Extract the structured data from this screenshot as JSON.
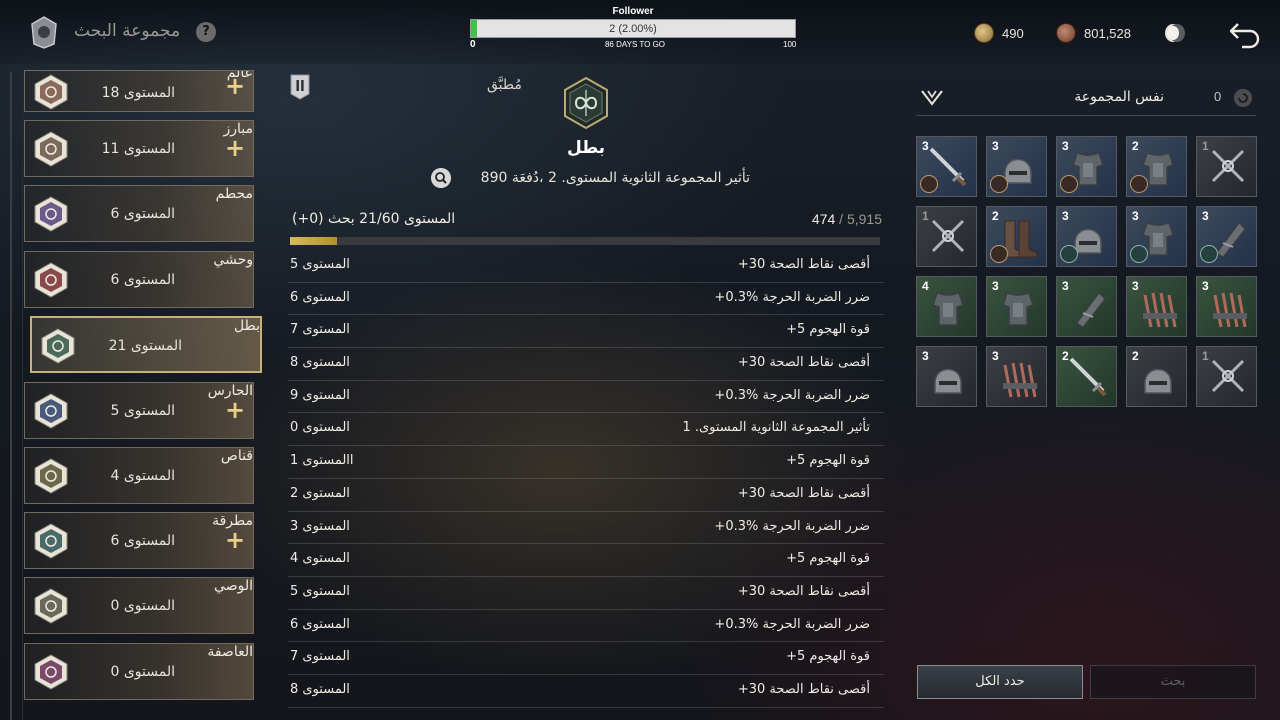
{
  "header": {
    "title": "مجموعة البحث",
    "help_label": "?"
  },
  "progress": {
    "title": "Follower",
    "value_text": "2 (2.00%)",
    "percent": 2.0,
    "min": "0",
    "max": "100",
    "days_left": "86 DAYS TO GO"
  },
  "resources": {
    "currency_a": "490",
    "currency_b": "801,528"
  },
  "left_list": [
    {
      "name": "عالم",
      "level": "المستوى 18",
      "plus": true,
      "emblem": "winged-emblem-icon"
    },
    {
      "name": "مبارز",
      "level": "المستوى 11",
      "plus": true,
      "emblem": "crossed-swords-emblem-icon"
    },
    {
      "name": "محطم",
      "level": "المستوى 6",
      "plus": false,
      "emblem": "fist-emblem-icon"
    },
    {
      "name": "وحشي",
      "level": "المستوى 6",
      "plus": false,
      "emblem": "beast-mask-emblem-icon"
    },
    {
      "name": "بطل",
      "level": "المستوى 21",
      "plus": false,
      "emblem": "infinity-emblem-icon",
      "selected": true
    },
    {
      "name": "الحارس",
      "level": "المستوى 5",
      "plus": true,
      "emblem": "gate-emblem-icon"
    },
    {
      "name": "قناص",
      "level": "المستوى 4",
      "plus": false,
      "emblem": "crosshair-emblem-icon"
    },
    {
      "name": "مطرقة",
      "level": "المستوى 6",
      "plus": true,
      "emblem": "hammer-emblem-icon"
    },
    {
      "name": "الوصي",
      "level": "المستوى 0",
      "plus": false,
      "emblem": "shield-emblem-icon"
    },
    {
      "name": "العاصفة",
      "level": "المستوى 0",
      "plus": false,
      "emblem": "swirl-emblem-icon"
    }
  ],
  "detail": {
    "applied_label": "مُطبَّق",
    "hero_name": "بطل",
    "sub_effect": "تأثير المجموعة الثانوية المستوى. 2 ،دُفعَة 890",
    "level_line": "(+0) المستوى 21/60 بحث",
    "xp_current": "474",
    "xp_sep": " / ",
    "xp_max": "5,915",
    "xp_fraction": 0.08,
    "rows": [
      {
        "level": "المستوى 5",
        "effect": "+30 أقصى نقاط الصحة"
      },
      {
        "level": "المستوى 6",
        "effect": "+0.3% ضرر الضربة الحرجة"
      },
      {
        "level": "المستوى 7",
        "effect": "+5 قوة الهجوم"
      },
      {
        "level": "المستوى 8",
        "effect": "+30 أقصى نقاط الصحة"
      },
      {
        "level": "المستوى 9",
        "effect": "+0.3% ضرر الضربة الحرجة"
      },
      {
        "level": "المستوى 0",
        "effect": "تأثير المجموعة الثانوية المستوى. 1"
      },
      {
        "level": "المستوى 1l",
        "effect": "+5 قوة الهجوم"
      },
      {
        "level": "المستوى 2",
        "effect": "+30 أقصى نقاط الصحة"
      },
      {
        "level": "المستوى 3",
        "effect": "+0.3% ضرر الضربة الحرجة"
      },
      {
        "level": "المستوى 4",
        "effect": "+5 قوة الهجوم"
      },
      {
        "level": "المستوى 5",
        "effect": "+30 أقصى نقاط الصحة"
      },
      {
        "level": "المستوى 6",
        "effect": "+0.3% ضرر الضربة الحرجة"
      },
      {
        "level": "المستوى 7",
        "effect": "+5 قوة الهجوم"
      },
      {
        "level": "المستوى 8",
        "effect": "+30 أقصى نقاط الصحة"
      }
    ]
  },
  "right_panel": {
    "title": "نفس المجموعة",
    "count": "0",
    "tiles": [
      {
        "count": "3",
        "kind": "sword",
        "bg": "blue",
        "badge": "red"
      },
      {
        "count": "3",
        "kind": "helmet",
        "bg": "blue",
        "badge": "red"
      },
      {
        "count": "3",
        "kind": "armor",
        "bg": "blue",
        "badge": "red"
      },
      {
        "count": "2",
        "kind": "armor",
        "bg": "blue",
        "badge": "red"
      },
      {
        "count": "1",
        "kind": "cross-sword",
        "bg": "dark",
        "badge": "none",
        "dim": true
      },
      {
        "count": "1",
        "kind": "cross-sword",
        "bg": "dark",
        "badge": "none",
        "dim": true
      },
      {
        "count": "2",
        "kind": "boots",
        "bg": "blue",
        "badge": "red"
      },
      {
        "count": "3",
        "kind": "helmet",
        "bg": "blue",
        "badge": "teal"
      },
      {
        "count": "3",
        "kind": "armor",
        "bg": "blue",
        "badge": "teal"
      },
      {
        "count": "3",
        "kind": "gauntlet",
        "bg": "blue",
        "badge": "teal"
      },
      {
        "count": "4",
        "kind": "armor",
        "bg": "green",
        "badge": "none"
      },
      {
        "count": "3",
        "kind": "armor",
        "bg": "green",
        "badge": "none"
      },
      {
        "count": "3",
        "kind": "gauntlet",
        "bg": "green",
        "badge": "none"
      },
      {
        "count": "3",
        "kind": "claws",
        "bg": "green",
        "badge": "none"
      },
      {
        "count": "3",
        "kind": "claws",
        "bg": "green",
        "badge": "none"
      },
      {
        "count": "3",
        "kind": "helmet",
        "bg": "dark",
        "badge": "none"
      },
      {
        "count": "3",
        "kind": "claws",
        "bg": "dark",
        "badge": "none"
      },
      {
        "count": "2",
        "kind": "sword",
        "bg": "green",
        "badge": "none"
      },
      {
        "count": "2",
        "kind": "helmet",
        "bg": "dark",
        "badge": "none"
      },
      {
        "count": "1",
        "kind": "cross-sword",
        "bg": "dark",
        "badge": "none",
        "dim": true
      }
    ],
    "select_all_label": "حدد الكل",
    "search_label": "بحث"
  },
  "colors": {
    "accent_gold": "#c9b27a",
    "progress_green": "#3fc24a",
    "xp_gold": "#d7b95e"
  }
}
